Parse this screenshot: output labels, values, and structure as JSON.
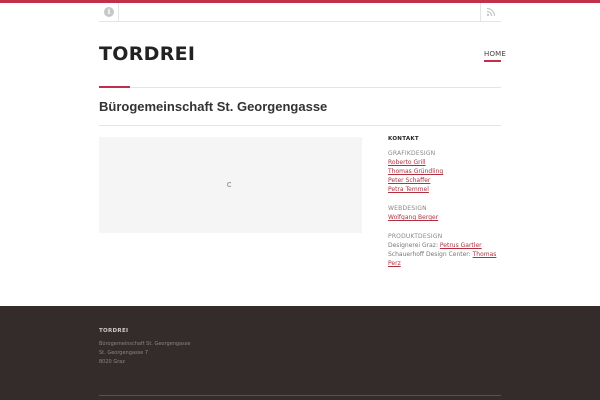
{
  "site": {
    "title": "TORDREI"
  },
  "nav": {
    "home": "HOME"
  },
  "page": {
    "title": "Bürogemeinschaft St. Georgengasse"
  },
  "sidebar": {
    "widget_title": "KONTAKT",
    "groups": [
      {
        "title": "GRAFIKDESIGN",
        "links": [
          "Roberto Grill",
          "Thomas Gründling",
          "Peter Schaffer",
          "Petra Temmel"
        ]
      },
      {
        "title": "WEBDESIGN",
        "links": [
          "Wolfgang Berger"
        ]
      }
    ],
    "produkt": {
      "title": "PRODUKTDESIGN",
      "line1_prefix": "Designerei Graz: ",
      "line1_link": "Petrus Gartler",
      "line2_prefix": "Schauerhoff Design Center: ",
      "line2_link_a": "Thomas",
      "line2_link_b": "Perz"
    }
  },
  "footer": {
    "title": "TORDREI",
    "lines": [
      "Bürogemeinschaft St. Georgengasse",
      "St. Georgengasse 7",
      "8020 Graz"
    ]
  },
  "colors": {
    "accent": "#c0304a",
    "footer_bg": "#332c2b",
    "link": "#b0303f"
  },
  "icons": {
    "top_left": "info-icon",
    "top_right": "rss-icon",
    "map_loader": "spinner-icon"
  }
}
